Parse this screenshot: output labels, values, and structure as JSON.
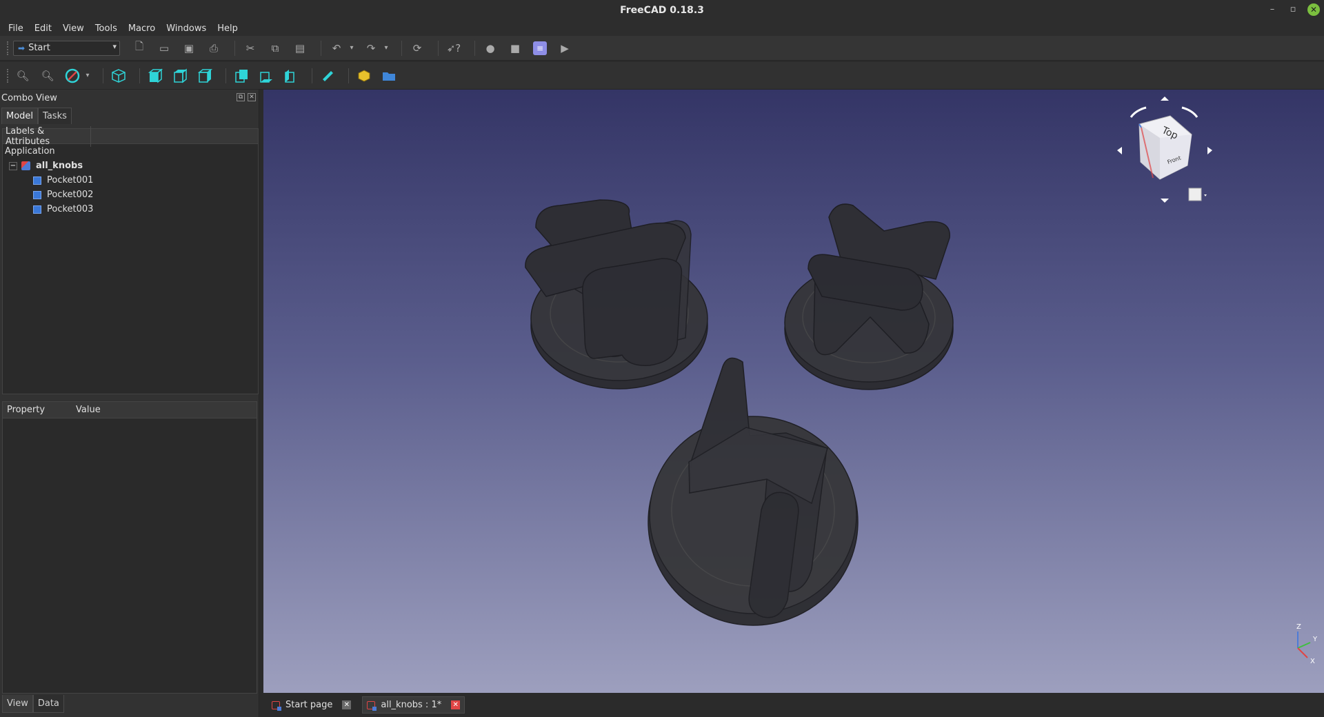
{
  "window": {
    "title": "FreeCAD 0.18.3"
  },
  "menu": [
    {
      "label": "File",
      "id": "file"
    },
    {
      "label": "Edit",
      "id": "edit"
    },
    {
      "label": "View",
      "id": "view"
    },
    {
      "label": "Tools",
      "id": "tools"
    },
    {
      "label": "Macro",
      "id": "macro"
    },
    {
      "label": "Windows",
      "id": "windows"
    },
    {
      "label": "Help",
      "id": "help"
    }
  ],
  "toolbar": {
    "workbench": "Start",
    "icons1": [
      "new-document-icon",
      "open-icon",
      "save-icon",
      "print-icon",
      "cut-icon",
      "copy-icon",
      "paste-icon",
      "undo-icon",
      "redo-icon",
      "refresh-icon",
      "whats-this-icon",
      "record-macro-icon",
      "stop-macro-icon",
      "macros-icon",
      "execute-macro-icon"
    ],
    "icons2": [
      "fit-all-icon",
      "fit-selection-icon",
      "draw-style-icon",
      "isometric-view-icon",
      "front-view-icon",
      "top-view-icon",
      "right-view-icon",
      "rear-view-icon",
      "bottom-view-icon",
      "left-view-icon",
      "measure-distance-icon",
      "part-icon",
      "group-icon"
    ]
  },
  "combo_view": {
    "title": "Combo View",
    "tabs": [
      "Model",
      "Tasks"
    ],
    "tree_header": "Labels & Attributes",
    "tree": {
      "application": "Application",
      "document": "all_knobs",
      "items": [
        "Pocket001",
        "Pocket002",
        "Pocket003"
      ]
    },
    "property_header": {
      "property": "Property",
      "value": "Value"
    },
    "bottom_tabs": [
      "View",
      "Data"
    ]
  },
  "navigation_cube": {
    "face_label": "Top",
    "side_label": "Front"
  },
  "axis": {
    "x": "X",
    "y": "Y",
    "z": "Z"
  },
  "document_tabs": [
    {
      "label": "Start page"
    },
    {
      "label": "all_knobs : 1*"
    }
  ],
  "colors": {
    "accent": "#2fd4d8",
    "close_active": "#e04545",
    "view_top": "#343566",
    "view_bottom": "#9d9fbe",
    "model_fill": "#2f2f33"
  }
}
